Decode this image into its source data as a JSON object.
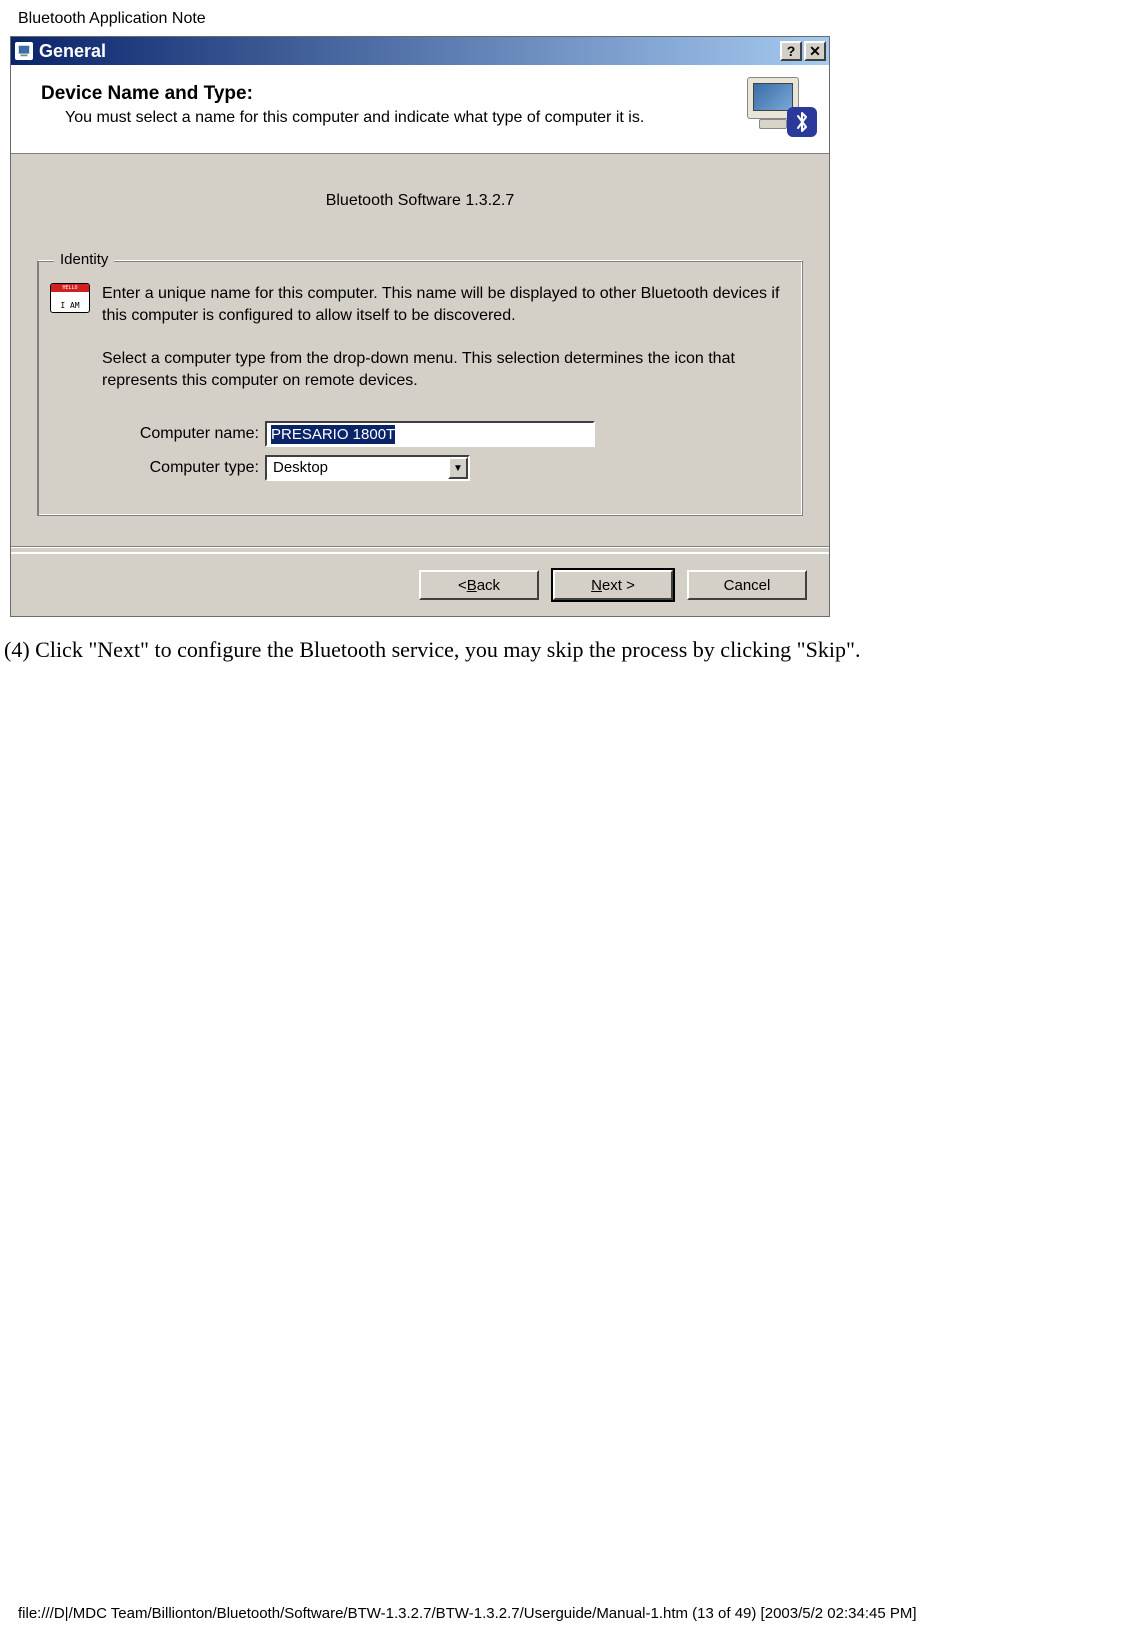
{
  "doc": {
    "header": "Bluetooth Application Note",
    "instruction": "(4) Click \"Next\" to configure the Bluetooth service, you may skip the process by clicking \"Skip\".",
    "footer": "file:///D|/MDC Team/Billionton/Bluetooth/Software/BTW-1.3.2.7/BTW-1.3.2.7/Userguide/Manual-1.htm (13 of 49) [2003/5/2 02:34:45 PM]"
  },
  "dialog": {
    "title": "General",
    "header_title": "Device Name and Type:",
    "header_sub": "You must select a name for this computer and indicate what type of computer it is.",
    "software_label": "Bluetooth Software 1.3.2.7",
    "fieldset_legend": "Identity",
    "identity_text_1": "Enter a unique name for this computer.  This name will be displayed to other Bluetooth devices if this computer is configured to allow itself to be discovered.",
    "identity_text_2": "Select a computer type from the drop-down menu.  This selection determines the icon that represents this computer on remote devices.",
    "name_badge_text": "I AM",
    "computer_name_label": "Computer name:",
    "computer_name_value": "PRESARIO 1800T",
    "computer_type_label": "Computer type:",
    "computer_type_value": "Desktop",
    "buttons": {
      "back": "< Back",
      "next": "Next >",
      "cancel": "Cancel"
    }
  }
}
